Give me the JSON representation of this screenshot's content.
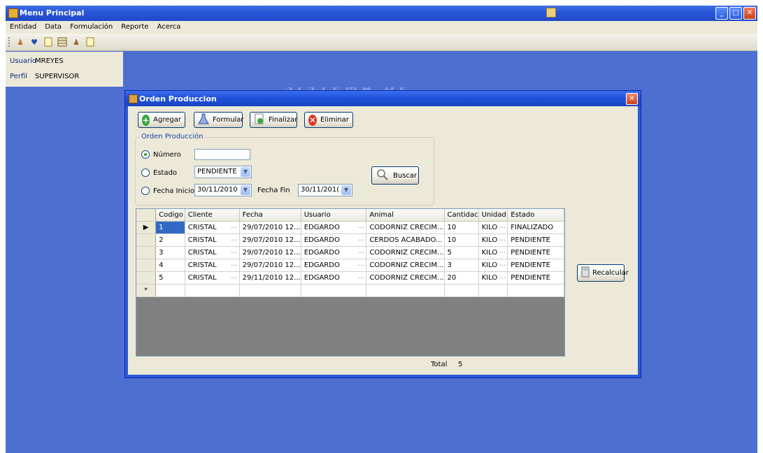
{
  "main_window": {
    "title": "Menu Principal"
  },
  "menu": [
    "Entidad",
    "Data",
    "Formulación",
    "Reporte",
    "Acerca"
  ],
  "toolbar_icons": [
    "person-icon",
    "heart-icon",
    "document-icon",
    "table-icon",
    "person-icon",
    "document-icon"
  ],
  "user_panel": {
    "usuario_label": "Usuario",
    "usuario_value": "MREYES",
    "perfil_label": "Perfil",
    "perfil_value": "SUPERVISOR"
  },
  "background_title": "SISTEMA DE FORMULACION",
  "child_window": {
    "title": "Orden Produccion"
  },
  "actions": {
    "agregar": "Agregar",
    "formular": "Formular",
    "finalizar": "Finalizar",
    "eliminar": "Eliminar"
  },
  "filter": {
    "legend": "Orden Producción",
    "numero_label": "Número",
    "numero_value": "",
    "estado_label": "Estado",
    "estado_value": "PENDIENTE",
    "fecha_inicio_label": "Fecha Inicio",
    "fecha_inicio_value": "30/11/2010",
    "fecha_fin_label": "Fecha Fin",
    "fecha_fin_value": "30/11/201(",
    "buscar": "Buscar"
  },
  "grid": {
    "headers": [
      "Codigo",
      "Cliente",
      "Fecha",
      "Usuario",
      "Animal",
      "Cantidac",
      "Unidad",
      "Estado"
    ],
    "rows": [
      [
        "1",
        "CRISTAL",
        "29/07/2010 12...",
        "EDGARDO",
        "CODORNIZ CRECIM...",
        "10",
        "KILO",
        "FINALIZADO"
      ],
      [
        "2",
        "CRISTAL",
        "29/07/2010 12...",
        "EDGARDO",
        "CERDOS ACABADO...",
        "10",
        "KILO",
        "PENDIENTE"
      ],
      [
        "3",
        "CRISTAL",
        "29/07/2010 12...",
        "EDGARDO",
        "CODORNIZ CRECIM...",
        "5",
        "KILO",
        "PENDIENTE"
      ],
      [
        "4",
        "CRISTAL",
        "29/07/2010 12...",
        "EDGARDO",
        "CODORNIZ CRECIM...",
        "3",
        "KILO",
        "PENDIENTE"
      ],
      [
        "5",
        "CRISTAL",
        "29/11/2010 12...",
        "EDGARDO",
        "CODORNIZ CRECIM...",
        "20",
        "KILO",
        "PENDIENTE"
      ]
    ],
    "current_row_marker": "▶",
    "new_row_marker": "*"
  },
  "total": {
    "label": "Total",
    "value": "5"
  },
  "recalcular": "Recalcular"
}
